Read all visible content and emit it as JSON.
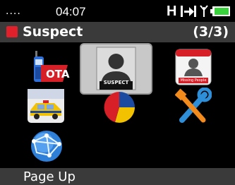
{
  "status": {
    "signal_dots": "....",
    "time": "04:07",
    "mode_letter": "H",
    "icons": [
      "arrow-to-bar-icon",
      "antenna-icon",
      "battery-icon"
    ],
    "battery_color": "#39d13c"
  },
  "header": {
    "title": "Suspect",
    "count": "(3/3)",
    "accent_color": "#e0202a"
  },
  "menu": {
    "items": [
      {
        "icon": "ota-radio-icon",
        "caption": "OTA"
      },
      {
        "icon": "suspect-silhouette-icon",
        "caption": "SUSPECT",
        "selected": true
      },
      {
        "icon": "missing-people-icon",
        "caption": "Missing People"
      },
      {
        "icon": "police-car-icon",
        "caption": ""
      },
      {
        "icon": "pie-chart-icon",
        "caption": ""
      },
      {
        "icon": "tools-icon",
        "caption": ""
      },
      {
        "icon": "globe-network-icon",
        "caption": ""
      }
    ]
  },
  "footer": {
    "softkey_label": "Page Up"
  }
}
